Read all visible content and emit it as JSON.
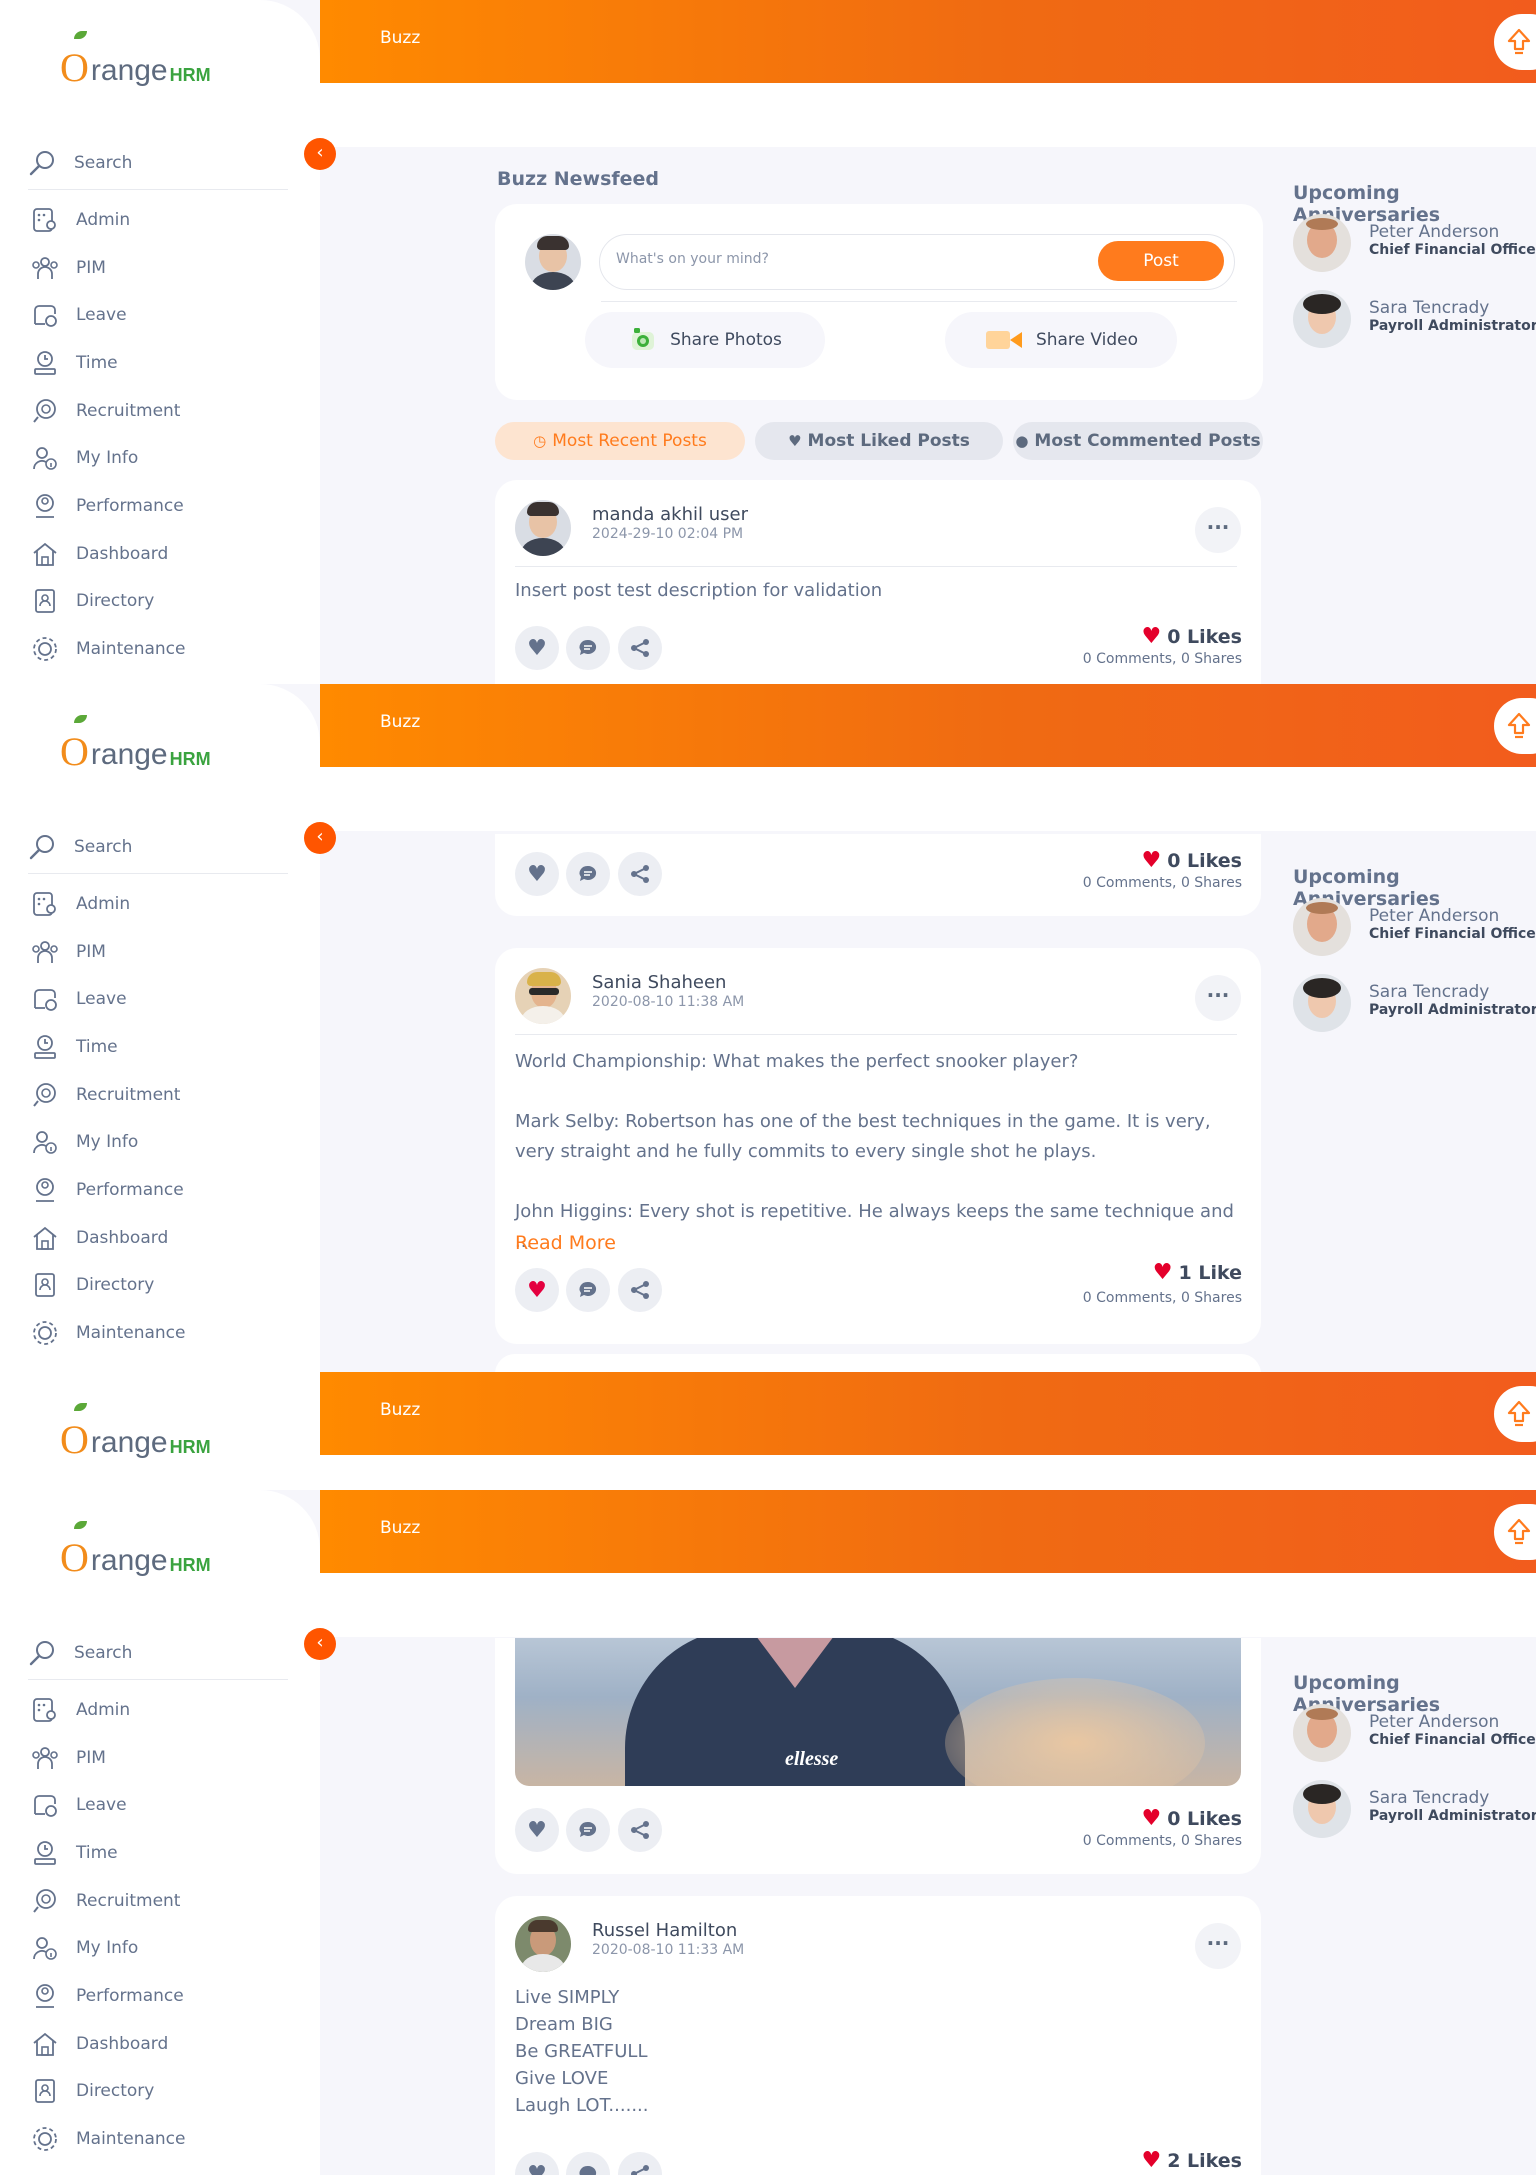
{
  "brand": {
    "letter": "O",
    "word": "range",
    "suffix": "HRM"
  },
  "header": {
    "title": "Buzz"
  },
  "sidebar": {
    "search_label": "Search",
    "items": [
      {
        "label": "Admin",
        "icon": "admin-icon"
      },
      {
        "label": "PIM",
        "icon": "pim-icon"
      },
      {
        "label": "Leave",
        "icon": "leave-icon"
      },
      {
        "label": "Time",
        "icon": "time-icon"
      },
      {
        "label": "Recruitment",
        "icon": "recruitment-icon"
      },
      {
        "label": "My Info",
        "icon": "myinfo-icon"
      },
      {
        "label": "Performance",
        "icon": "performance-icon"
      },
      {
        "label": "Dashboard",
        "icon": "dashboard-icon"
      },
      {
        "label": "Directory",
        "icon": "directory-icon"
      },
      {
        "label": "Maintenance",
        "icon": "maintenance-icon"
      }
    ]
  },
  "newsfeed": {
    "title": "Buzz Newsfeed",
    "placeholder": "What's on your mind?",
    "post_label": "Post",
    "share_photos": "Share Photos",
    "share_video": "Share Video",
    "tabs": [
      "Most Recent Posts",
      "Most Liked Posts",
      "Most Commented Posts"
    ]
  },
  "posts": [
    {
      "author": "manda akhil user",
      "date": "2024-29-10 02:04 PM",
      "text": "Insert post test description for validation",
      "likes": "0 Likes",
      "stats": "0 Comments, 0 Shares"
    },
    {
      "likes": "0 Likes",
      "stats": "0 Comments, 0 Shares"
    },
    {
      "author": "Sania Shaheen",
      "date": "2020-08-10 11:38 AM",
      "para1": "World Championship: What makes the perfect snooker player?",
      "para2": "Mark Selby: Robertson has one of the best techniques in the game. It is very, very straight and he fully commits to every single shot he plays.",
      "para3": "John Higgins: Every shot is repetitive. He always keeps the same technique and ...",
      "read_more": "Read More",
      "likes": "1 Like",
      "stats": "0 Comments, 0 Shares"
    },
    {
      "photo_text": "ellesse",
      "likes": "0 Likes",
      "stats": "0 Comments, 0 Shares"
    },
    {
      "author": "Russel Hamilton",
      "date": "2020-08-10 11:33 AM",
      "lines": [
        "Live SIMPLY",
        "Dream BIG",
        "Be GREATFULL",
        "Give LOVE",
        "Laugh LOT......."
      ],
      "likes": "2 Likes"
    }
  ],
  "anniversaries": {
    "title": "Upcoming Anniversaries",
    "people": [
      {
        "name": "Peter Anderson",
        "role": "Chief Financial Officer"
      },
      {
        "name": "Sara Tencrady",
        "role": "Payroll Administrator"
      }
    ]
  }
}
